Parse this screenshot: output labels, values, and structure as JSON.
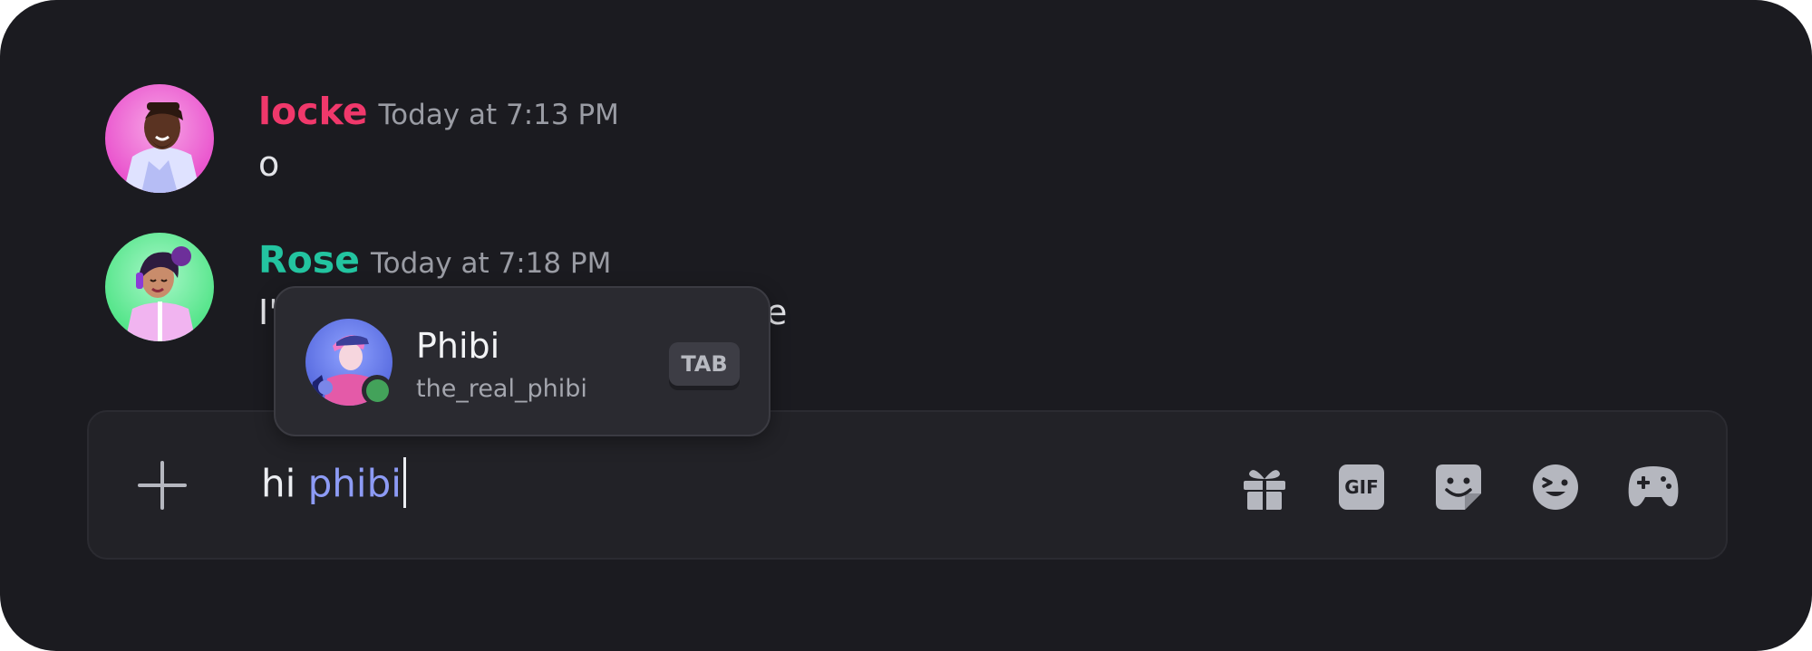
{
  "messages": [
    {
      "author": "locke",
      "author_color": "#f0386b",
      "timestamp": "Today at 7:13 PM",
      "text": "o",
      "avatar_icon": "locke-avatar"
    },
    {
      "author": "Rose",
      "author_color": "#23c4a0",
      "timestamp": "Today at 7:18 PM",
      "text": "I'",
      "text_tail": "e",
      "avatar_icon": "rose-avatar"
    }
  ],
  "autocomplete": {
    "display_name": "Phibi",
    "username": "the_real_phibi",
    "key_hint": "TAB",
    "status": "online",
    "status_color": "#43a25a",
    "avatar_icon": "phibi-avatar"
  },
  "composer": {
    "text_prefix": "hi ",
    "mention_text": "phibi",
    "mention_color": "#8d9bf5",
    "attach_icon": "plus-icon",
    "toolbar_icons": [
      "gift-icon",
      "gif-icon",
      "sticker-icon",
      "emoji-icon",
      "game-controller-icon"
    ],
    "gif_label": "GIF"
  }
}
